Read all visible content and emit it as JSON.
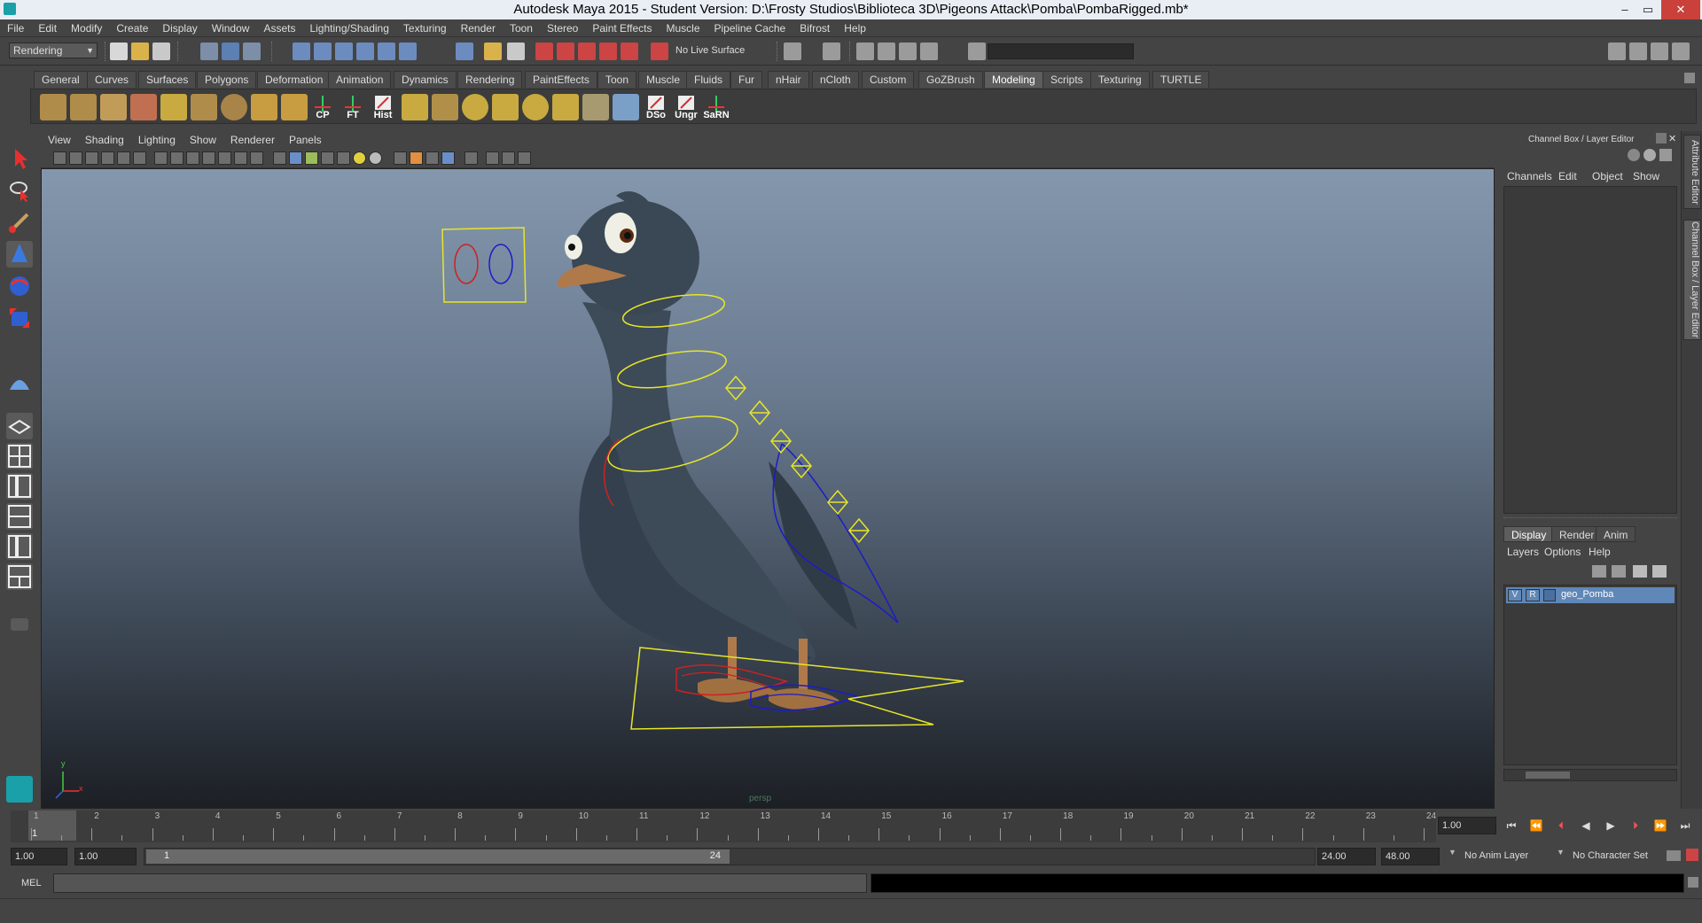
{
  "window": {
    "title": "Autodesk Maya 2015 - Student Version: D:\\Frosty Studios\\Biblioteca 3D\\Pigeons Attack\\Pomba\\PombaRigged.mb*",
    "minimize": "–",
    "maximize": "▭",
    "close": "✕"
  },
  "menubar": [
    "File",
    "Edit",
    "Modify",
    "Create",
    "Display",
    "Window",
    "Assets",
    "Lighting/Shading",
    "Texturing",
    "Render",
    "Toon",
    "Stereo",
    "Paint Effects",
    "Muscle",
    "Pipeline Cache",
    "Bifrost",
    "Help"
  ],
  "statusline": {
    "menuset": "Rendering",
    "live_surface": "No Live Surface"
  },
  "shelf_tabs": [
    "General",
    "Curves",
    "Surfaces",
    "Polygons",
    "Deformation",
    "Animation",
    "Dynamics",
    "Rendering",
    "PaintEffects",
    "Toon",
    "Muscle",
    "Fluids",
    "Fur",
    "nHair",
    "nCloth",
    "Custom",
    "GoZBrush",
    "Modeling",
    "Scripts",
    "Texturing",
    "TURTLE"
  ],
  "shelf_active": "Modeling",
  "shelf_labels": [
    "CP",
    "FT",
    "Hist",
    "DSo",
    "Ungr",
    "SaRN"
  ],
  "panel_menu": [
    "View",
    "Shading",
    "Lighting",
    "Show",
    "Renderer",
    "Panels"
  ],
  "viewport": {
    "camera_label": "persp",
    "axis_y": "y",
    "axis_x": "x"
  },
  "channel_box": {
    "title": "Channel Box / Layer Editor",
    "menu": [
      "Channels",
      "Edit",
      "Object",
      "Show"
    ]
  },
  "layer_editor": {
    "tabs": [
      "Display",
      "Render",
      "Anim"
    ],
    "active_tab": "Display",
    "menu": [
      "Layers",
      "Options",
      "Help"
    ],
    "layers": [
      {
        "v": "V",
        "r": "R",
        "name": "geo_Pomba"
      }
    ]
  },
  "side_tabs": [
    "Attribute Editor",
    "Channel Box / Layer Editor"
  ],
  "timeslider": {
    "ticks": [
      "1",
      "2",
      "3",
      "4",
      "5",
      "6",
      "7",
      "8",
      "9",
      "10",
      "11",
      "12",
      "13",
      "14",
      "15",
      "16",
      "17",
      "18",
      "19",
      "20",
      "21",
      "22",
      "23",
      "24"
    ],
    "current_frame_marker": "1",
    "current_time": "1.00"
  },
  "range": {
    "start_time": "1.00",
    "playback_start": "1.00",
    "slider_start": "1",
    "slider_end": "24",
    "playback_end": "24.00",
    "end_time": "48.00",
    "anim_layer": "No Anim Layer",
    "character_set": "No Character Set"
  },
  "command_line": {
    "label": "MEL"
  },
  "colors": {
    "accent": "#5f87b8",
    "rig_yellow": "#e6e627",
    "rig_red": "#cc2222",
    "rig_blue": "#1c1cc8",
    "pigeon_body": "#3d4a58",
    "beak": "#b0794a"
  }
}
